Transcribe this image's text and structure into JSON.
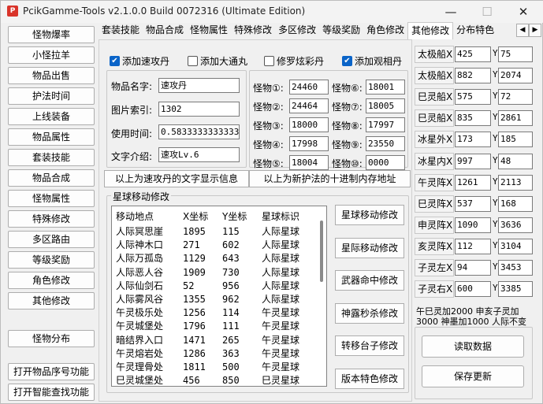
{
  "window": {
    "title": "PcikGamme-Tools v2.1.0.0 Build 0072316 (Ultimate Edition)",
    "icon_letter": "P"
  },
  "sidebar": {
    "items": [
      "怪物爆率",
      "小怪拉羊",
      "物品出售",
      "护法时间",
      "上线装备",
      "物品属性",
      "套装技能",
      "物品合成",
      "怪物属性",
      "特殊修改",
      "多区路由",
      "等级奖励",
      "角色修改",
      "其他修改"
    ],
    "monster_dist": "怪物分布",
    "open_item_serial": "打开物品序号功能",
    "open_smart_search": "打开智能查找功能"
  },
  "tabs": {
    "items": [
      "套装技能",
      "物品合成",
      "怪物属性",
      "特殊修改",
      "多区修改",
      "等级奖励",
      "角色修改",
      "其他修改",
      "分布特色"
    ],
    "active_index": 7
  },
  "checkboxes": [
    {
      "label": "添加速攻丹",
      "checked": true
    },
    {
      "label": "添加大通丸",
      "checked": false
    },
    {
      "label": "修罗炫彩丹",
      "checked": false
    },
    {
      "label": "添加观相丹",
      "checked": true
    }
  ],
  "item_form": {
    "name_label": "物品名字:",
    "name_value": "速攻丹",
    "icon_label": "图片索引:",
    "icon_value": "1302",
    "time_label": "使用时间:",
    "time_value": "0.5833333333333",
    "desc_label": "文字介绍:",
    "desc_value": "速攻Lv.6"
  },
  "monsters": [
    {
      "label": "怪物①:",
      "value": "24460"
    },
    {
      "label": "怪物⑥:",
      "value": "18001"
    },
    {
      "label": "怪物②:",
      "value": "24464"
    },
    {
      "label": "怪物⑦:",
      "value": "18005"
    },
    {
      "label": "怪物③:",
      "value": "18000"
    },
    {
      "label": "怪物⑧:",
      "value": "17997"
    },
    {
      "label": "怪物④:",
      "value": "17998"
    },
    {
      "label": "怪物⑨:",
      "value": "23550"
    },
    {
      "label": "怪物⑤:",
      "value": "18004"
    },
    {
      "label": "怪物⑩:",
      "value": "0000"
    }
  ],
  "info_buttons": {
    "text_info": "以上为速攻丹的文字显示信息",
    "hex_addr": "以上为新护法的十进制内存地址"
  },
  "star_move": {
    "group_title": "星球移动修改",
    "headers": [
      "移动地点",
      "X坐标",
      "Y坐标",
      "星球标识"
    ],
    "rows": [
      [
        "人际冥思崖",
        "1895",
        "115",
        "人际星球"
      ],
      [
        "人际神木口",
        "271",
        "602",
        "人际星球"
      ],
      [
        "人际万孤岛",
        "1129",
        "643",
        "人际星球"
      ],
      [
        "人际恶人谷",
        "1909",
        "730",
        "人际星球"
      ],
      [
        "人际仙剑石",
        "52",
        "956",
        "人际星球"
      ],
      [
        "人际雾风谷",
        "1355",
        "962",
        "人际星球"
      ],
      [
        "午灵极乐处",
        "1256",
        "114",
        "午灵星球"
      ],
      [
        "午灵城堡处",
        "1796",
        "111",
        "午灵星球"
      ],
      [
        "暗结界入口",
        "1471",
        "265",
        "午灵星球"
      ],
      [
        "午灵熔岩处",
        "1286",
        "363",
        "午灵星球"
      ],
      [
        "午灵理骨处",
        "1811",
        "500",
        "午灵星球"
      ],
      [
        "巳灵城堡处",
        "456",
        "850",
        "巳灵星球"
      ]
    ]
  },
  "action_buttons": [
    "星球移动修改",
    "星际移动修改",
    "武器命中修改",
    "神露秒杀修改",
    "转移台子修改",
    "版本特色修改"
  ],
  "coords": [
    {
      "label": "太极船X",
      "x": "425",
      "y": "75"
    },
    {
      "label": "太极船X",
      "x": "882",
      "y": "2074"
    },
    {
      "label": "巳灵船X",
      "x": "575",
      "y": "72"
    },
    {
      "label": "巳灵船X",
      "x": "835",
      "y": "2861"
    },
    {
      "label": "冰星外X",
      "x": "173",
      "y": "185"
    },
    {
      "label": "冰星内X",
      "x": "997",
      "y": "48"
    },
    {
      "label": "午灵阵X",
      "x": "1261",
      "y": "2113"
    },
    {
      "label": "巳灵阵X",
      "x": "537",
      "y": "168"
    },
    {
      "label": "申灵阵X",
      "x": "1090",
      "y": "3636"
    },
    {
      "label": "亥灵阵X",
      "x": "112",
      "y": "3104"
    },
    {
      "label": "子灵左X",
      "x": "94",
      "y": "3453"
    },
    {
      "label": "子灵右X",
      "x": "600",
      "y": "3385"
    }
  ],
  "y_label": "Y",
  "notes": {
    "line1": "午巳灵加2000 申亥子灵加",
    "line2": "3000 神墨加1000 人际不变"
  },
  "read_button": "读取数据",
  "save_button": "保存更新"
}
